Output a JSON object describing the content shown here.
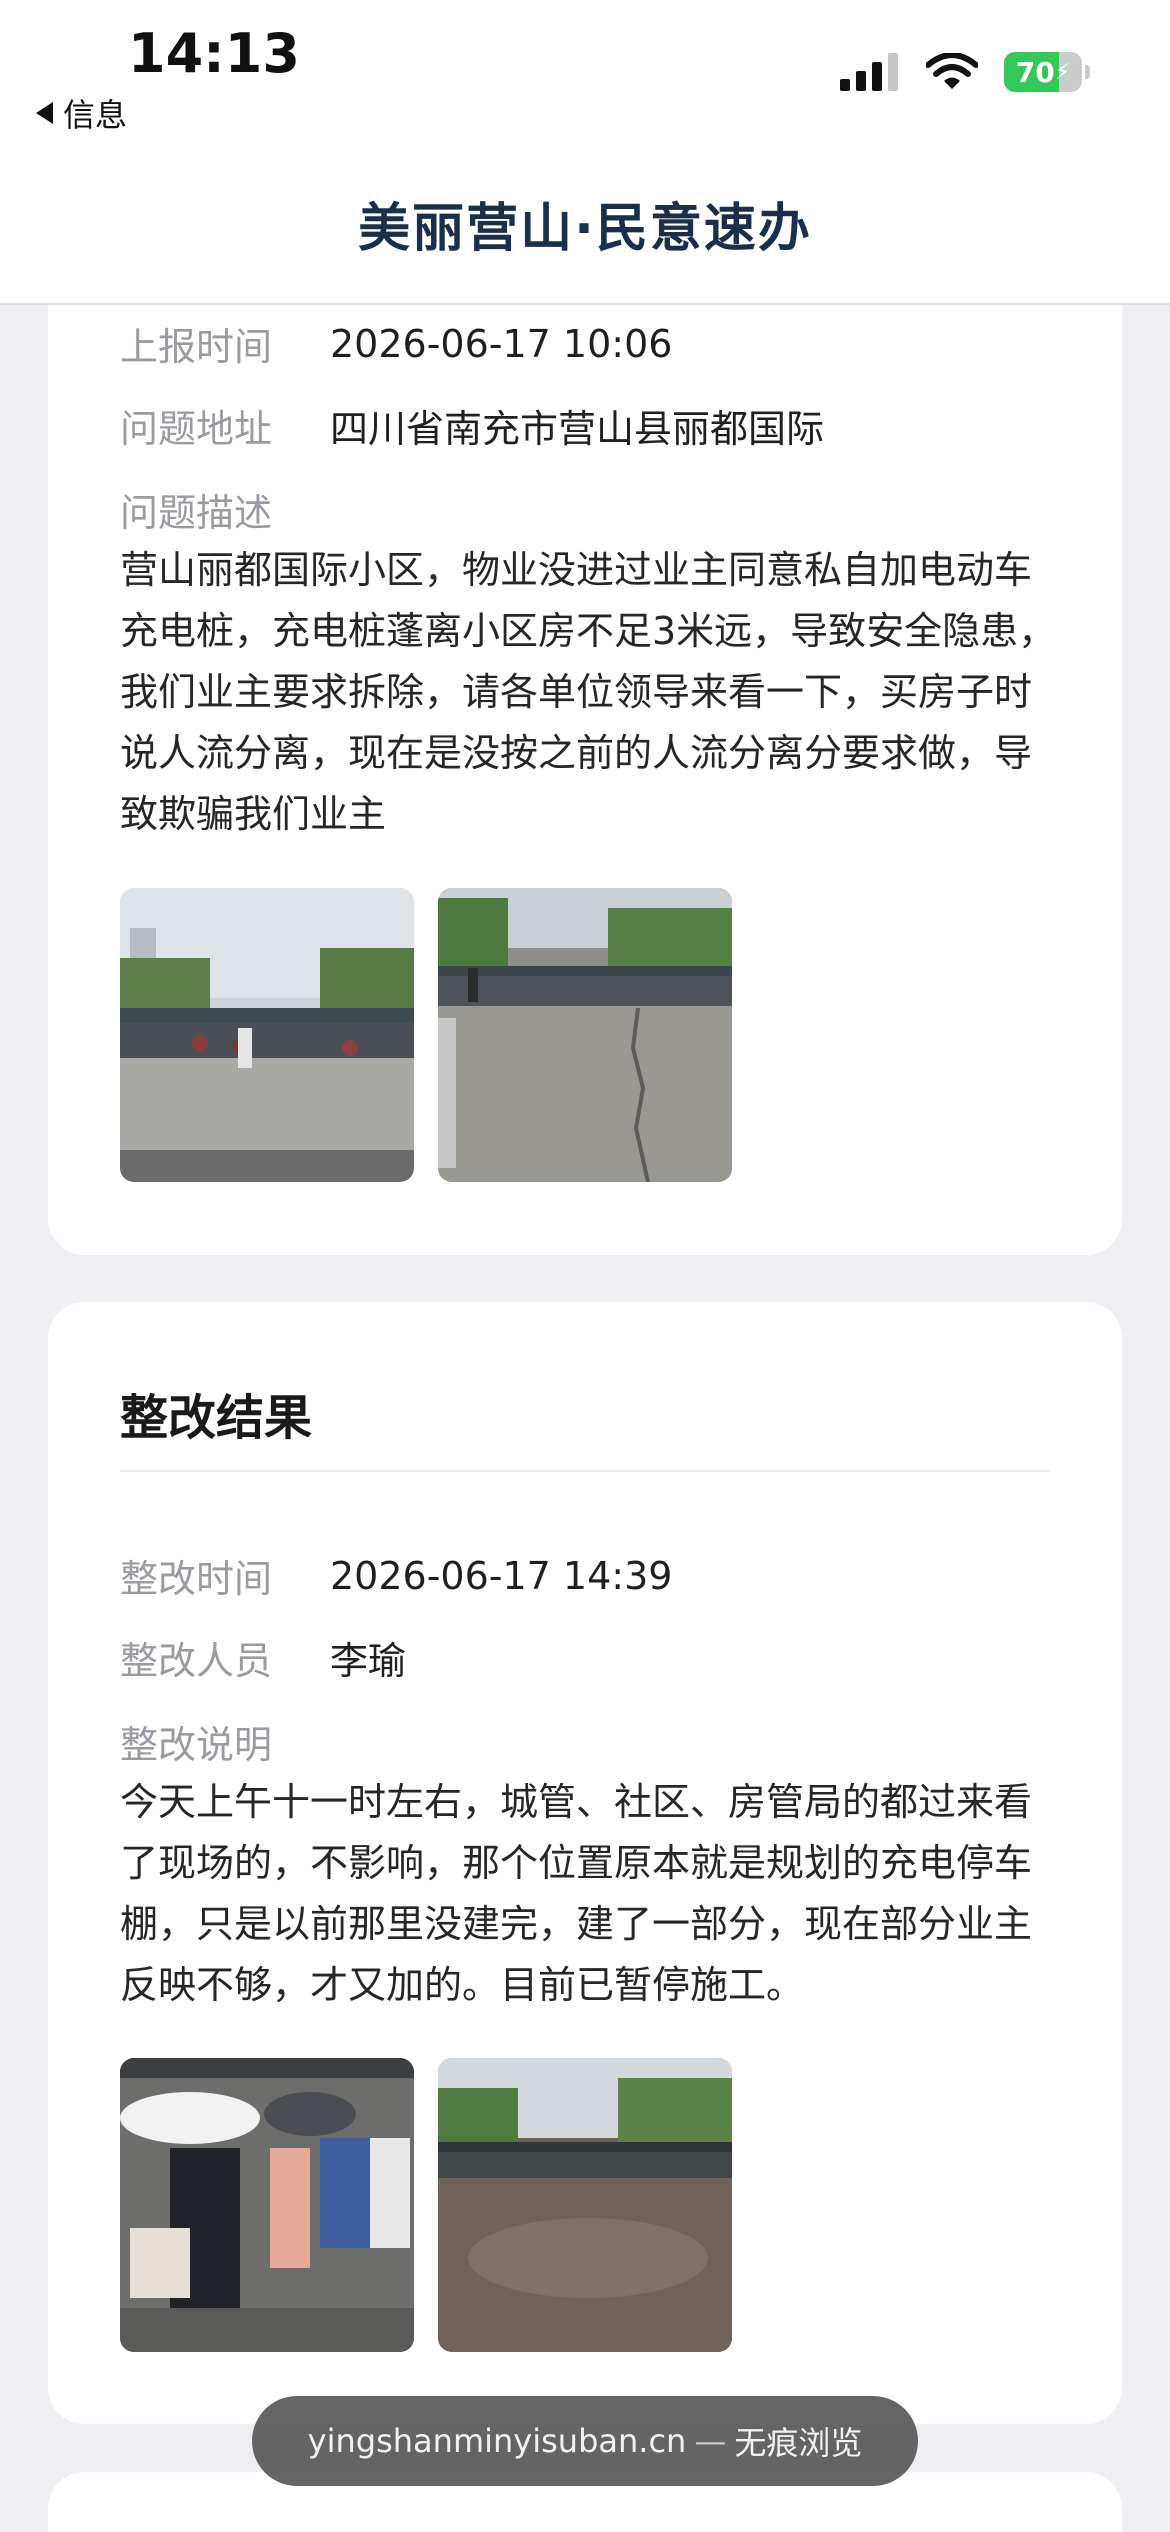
{
  "status_bar": {
    "time": "14:13",
    "back_label": "信息",
    "battery_level": 70,
    "battery_text": "70"
  },
  "header": {
    "title": "美丽营山·民意速办"
  },
  "report": {
    "fields": [
      {
        "label": "上报时间",
        "value": "2026-06-17 10:06"
      },
      {
        "label": "问题地址",
        "value": "四川省南充市营山县丽都国际"
      }
    ],
    "description_label": "问题描述",
    "description": "营山丽都国际小区，物业没进过业主同意私自加电动车充电桩，充电桩蓬离小区房不足3米远，导致安全隐患，我们业主要求拆除，请各单位领导来看一下，买房子时说人流分离，现在是没按之前的人流分离分要求做，导致欺骗我们业主",
    "photos": [
      "report-photo-1",
      "report-photo-2"
    ]
  },
  "rectification": {
    "section_title": "整改结果",
    "fields": [
      {
        "label": "整改时间",
        "value": "2026-06-17 14:39"
      },
      {
        "label": "整改人员",
        "value": "李瑜"
      }
    ],
    "description_label": "整改说明",
    "description": "今天上午十一时左右，城管、社区、房管局的都过来看了现场的，不影响，那个位置原本就是规划的充电停车棚，只是以前那里没建完，建了一部分，现在部分业主反映不够，才又加的。目前已暂停施工。",
    "photos": [
      "result-photo-1",
      "result-photo-2"
    ]
  },
  "toast": {
    "domain": "yingshanminyisuban.cn",
    "separator": "—",
    "mode": "无痕浏览"
  },
  "colors": {
    "title": "#1c2f4a",
    "battery": "#34c759",
    "label": "#9a9aa2",
    "background": "#eeeef3"
  }
}
